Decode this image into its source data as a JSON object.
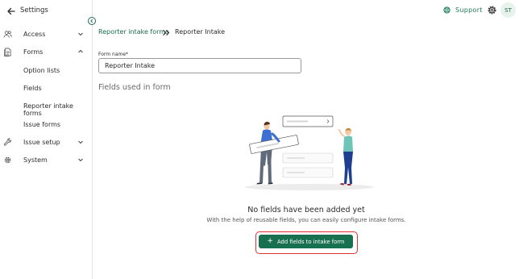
{
  "sidebar": {
    "title": "Settings",
    "items": [
      {
        "label": "Access",
        "icon": "users-icon",
        "expanded": false
      },
      {
        "label": "Forms",
        "icon": "document-icon",
        "expanded": true
      },
      {
        "label": "Issue setup",
        "icon": "wrench-icon",
        "expanded": false
      },
      {
        "label": "System",
        "icon": "gear-icon",
        "expanded": false
      }
    ],
    "forms_children": [
      "Option lists",
      "Fields",
      "Reporter intake forms",
      "Issue forms"
    ]
  },
  "topbar": {
    "support_label": "Support",
    "avatar_initials": "ST"
  },
  "breadcrumb": {
    "parent": "Reporter intake forms",
    "current": "Reporter Intake"
  },
  "form": {
    "name_label": "Form name*",
    "name_value": "Reporter Intake"
  },
  "section": {
    "title": "Fields used in form"
  },
  "empty_state": {
    "title": "No fields have been added yet",
    "description": "With the help of reusable fields, you can easily configure intake forms.",
    "button_label": "Add fields to intake form"
  },
  "colors": {
    "accent": "#17704f",
    "highlight": "#e03131"
  }
}
